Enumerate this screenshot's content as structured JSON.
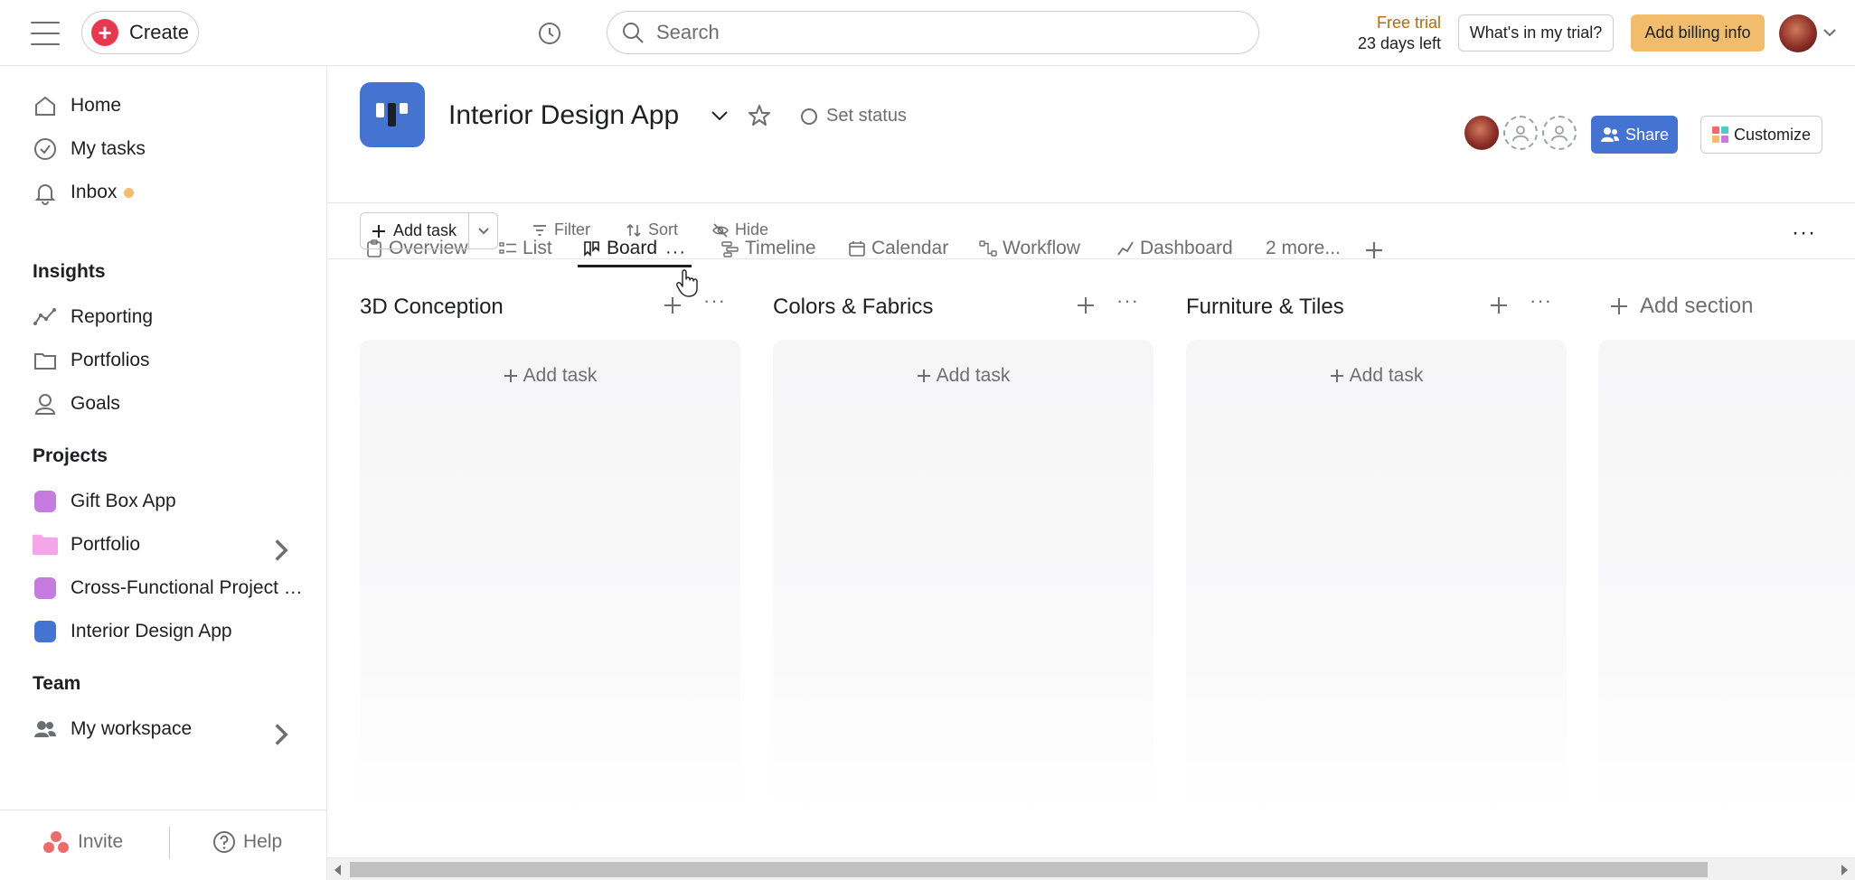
{
  "topbar": {
    "create_label": "Create",
    "search_placeholder": "Search",
    "trial_label": "Free trial",
    "trial_days": "23 days left",
    "whats_in_trial": "What's in my trial?",
    "billing_label": "Add billing info"
  },
  "sidebar": {
    "nav": [
      {
        "label": "Home",
        "icon": "home-icon"
      },
      {
        "label": "My tasks",
        "icon": "check-circle-icon"
      },
      {
        "label": "Inbox",
        "icon": "bell-icon"
      }
    ],
    "insights_title": "Insights",
    "insights": [
      {
        "label": "Reporting",
        "icon": "line-chart-icon"
      },
      {
        "label": "Portfolios",
        "icon": "folder-icon"
      },
      {
        "label": "Goals",
        "icon": "person-icon"
      }
    ],
    "projects_title": "Projects",
    "projects": [
      {
        "label": "Gift Box App",
        "color": "#c67be0"
      },
      {
        "label": "Portfolio",
        "color": "#f4a6e8"
      },
      {
        "label": "Cross-Functional Project P...",
        "color": "#c67be0"
      },
      {
        "label": "Interior Design App",
        "color": "#4573d2"
      }
    ],
    "team_title": "Team",
    "team": [
      {
        "label": "My workspace",
        "icon": "people-icon"
      }
    ],
    "invite_label": "Invite",
    "help_label": "Help"
  },
  "project": {
    "title": "Interior Design App",
    "set_status": "Set status",
    "share_label": "Share",
    "customize_label": "Customize",
    "accent": "#4573d2"
  },
  "tabs": [
    {
      "label": "Overview",
      "icon": "clipboard-icon"
    },
    {
      "label": "List",
      "icon": "list-icon"
    },
    {
      "label": "Board",
      "icon": "board-icon",
      "active": true
    },
    {
      "label": "Timeline",
      "icon": "timeline-icon"
    },
    {
      "label": "Calendar",
      "icon": "calendar-icon"
    },
    {
      "label": "Workflow",
      "icon": "workflow-icon"
    },
    {
      "label": "Dashboard",
      "icon": "dashboard-icon"
    },
    {
      "label": "2 more...",
      "icon": ""
    }
  ],
  "toolbar": {
    "add_task": "Add task",
    "filter": "Filter",
    "sort": "Sort",
    "hide": "Hide"
  },
  "columns": [
    {
      "title": "3D Conception",
      "add_task": "Add task"
    },
    {
      "title": "Colors & Fabrics",
      "add_task": "Add task"
    },
    {
      "title": "Furniture & Tiles",
      "add_task": "Add task"
    }
  ],
  "add_section": "Add section"
}
